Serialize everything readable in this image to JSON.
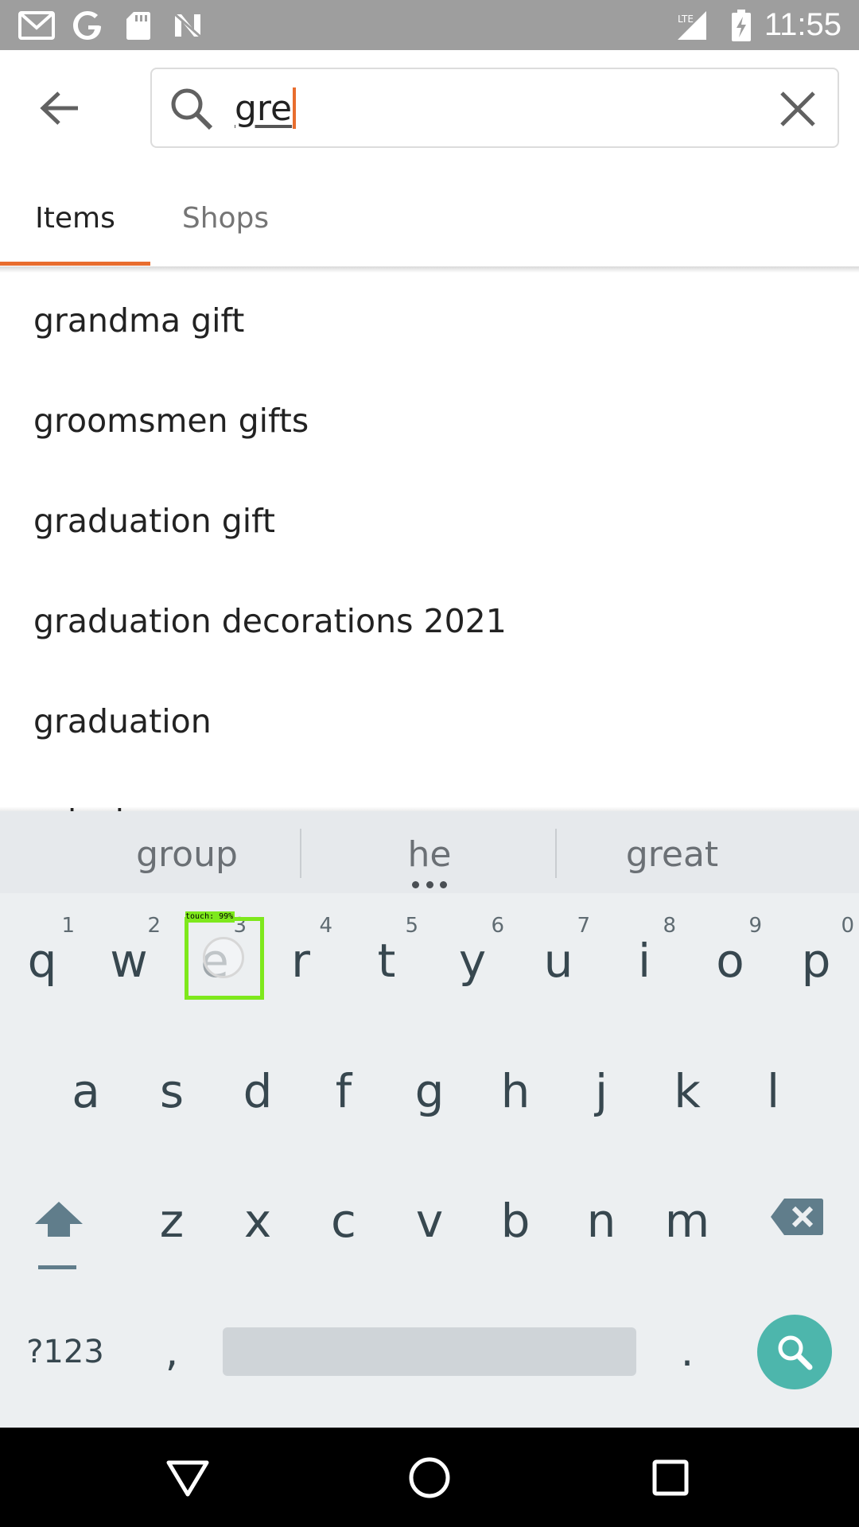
{
  "status_bar": {
    "time": "11:55",
    "icons": [
      "gmail-icon",
      "google-icon",
      "sd-card-icon",
      "n-icon",
      "lte-signal-icon",
      "battery-charging-icon"
    ],
    "network_label": "LTE"
  },
  "search": {
    "query": "gre"
  },
  "tabs": [
    {
      "label": "Items",
      "selected": true
    },
    {
      "label": "Shops",
      "selected": false
    }
  ],
  "suggestions": [
    "grandma gift",
    "groomsmen gifts",
    "graduation gift",
    "graduation decorations 2021",
    "graduation",
    "grinch"
  ],
  "keyboard": {
    "strip": [
      "group",
      "he",
      "great"
    ],
    "row1": [
      {
        "ch": "q",
        "hint": "1"
      },
      {
        "ch": "w",
        "hint": "2"
      },
      {
        "ch": "e",
        "hint": "3"
      },
      {
        "ch": "r",
        "hint": "4"
      },
      {
        "ch": "t",
        "hint": "5"
      },
      {
        "ch": "y",
        "hint": "6"
      },
      {
        "ch": "u",
        "hint": "7"
      },
      {
        "ch": "i",
        "hint": "8"
      },
      {
        "ch": "o",
        "hint": "9"
      },
      {
        "ch": "p",
        "hint": "0"
      }
    ],
    "row2": [
      "a",
      "s",
      "d",
      "f",
      "g",
      "h",
      "j",
      "k",
      "l"
    ],
    "row3": [
      "z",
      "x",
      "c",
      "v",
      "b",
      "n",
      "m"
    ],
    "symbols_label": "?123",
    "comma": ",",
    "period": ".",
    "touch_label": "touch: 99%"
  },
  "colors": {
    "accent": "#e86d2e",
    "keyboard_bg": "#eceff1",
    "search_key": "#4db6ac",
    "touch_box": "#7ee81c"
  }
}
